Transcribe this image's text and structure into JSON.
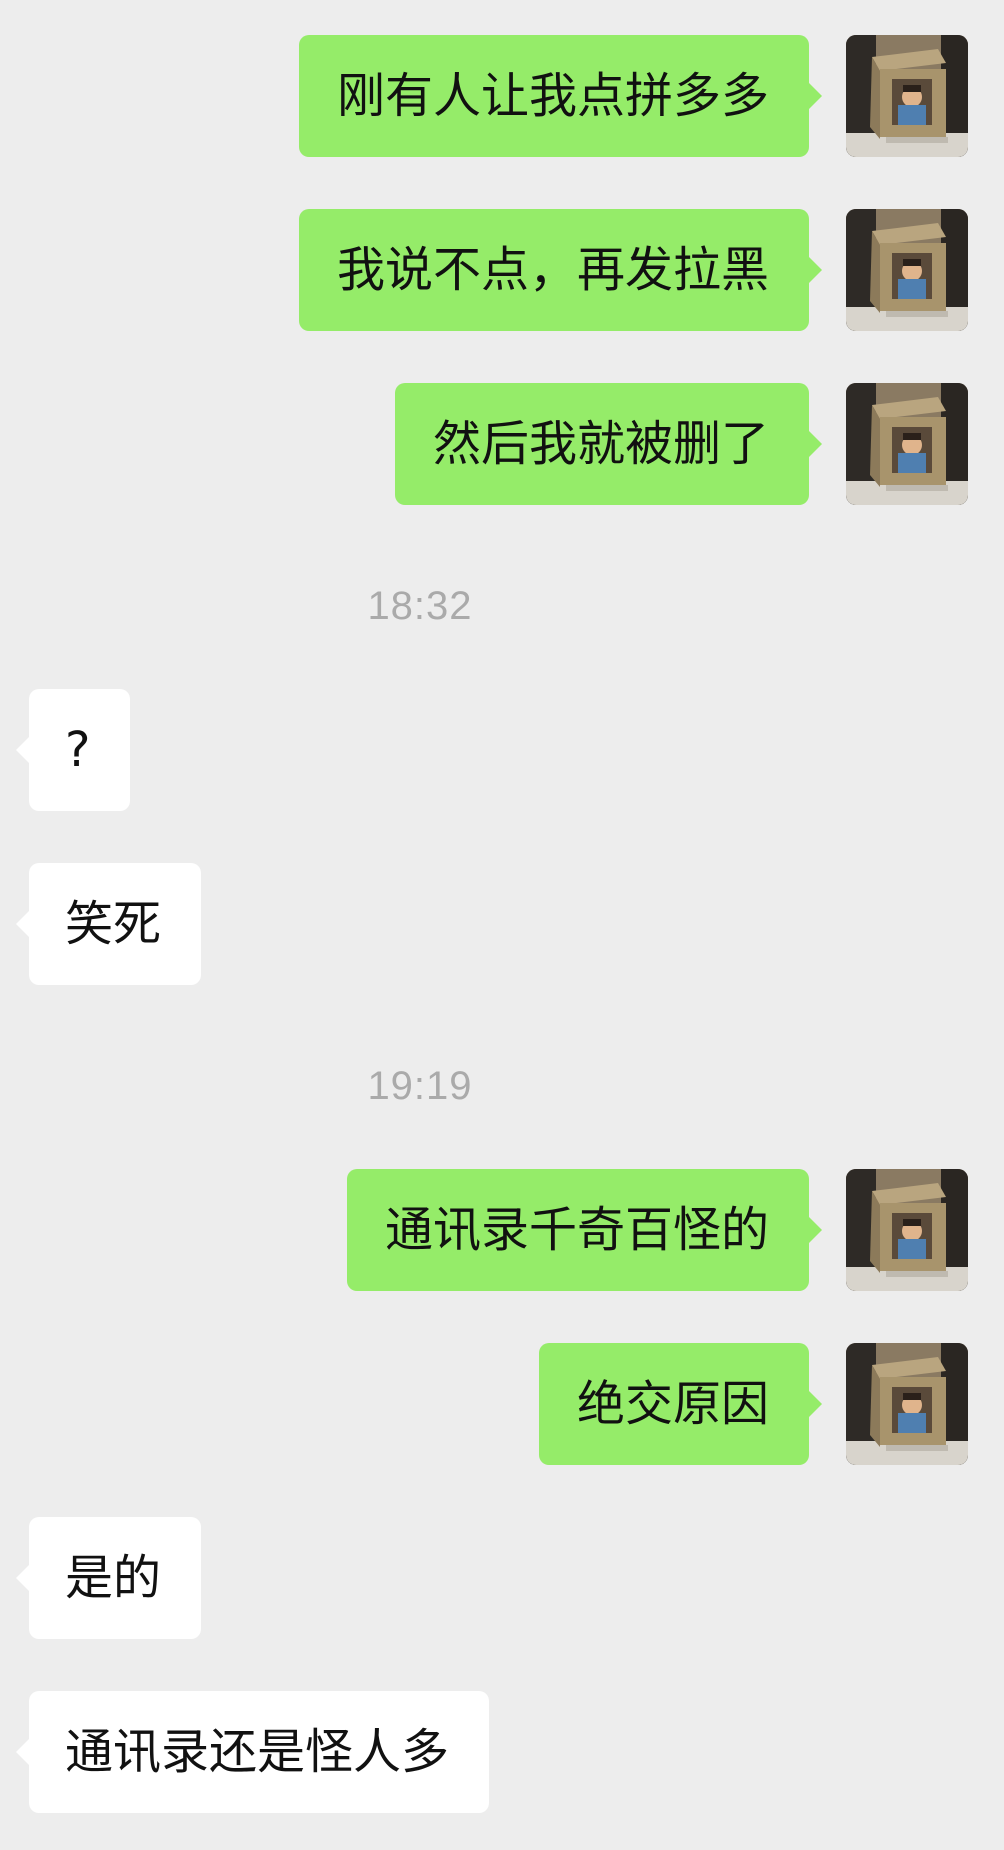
{
  "chat": {
    "messages": [
      {
        "side": "sent",
        "text": "刚有人让我点拼多多"
      },
      {
        "side": "sent",
        "text": "我说不点，再发拉黑"
      },
      {
        "side": "sent",
        "text": "然后我就被删了"
      },
      {
        "type": "time",
        "text": "18:32"
      },
      {
        "side": "received",
        "text": "?"
      },
      {
        "side": "received",
        "text": "笑死"
      },
      {
        "type": "time",
        "text": "19:19"
      },
      {
        "side": "sent",
        "text": "通讯录千奇百怪的"
      },
      {
        "side": "sent",
        "text": "绝交原因"
      },
      {
        "side": "received",
        "text": "是的"
      },
      {
        "side": "received",
        "text": "通讯录还是怪人多"
      }
    ]
  },
  "colors": {
    "background": "#ededed",
    "sent_bubble": "#95ec69",
    "received_bubble": "#ffffff",
    "text": "#111111",
    "timestamp": "#aaaaaa"
  },
  "icons": {
    "self_avatar": "photo-avatar-person-in-box"
  }
}
